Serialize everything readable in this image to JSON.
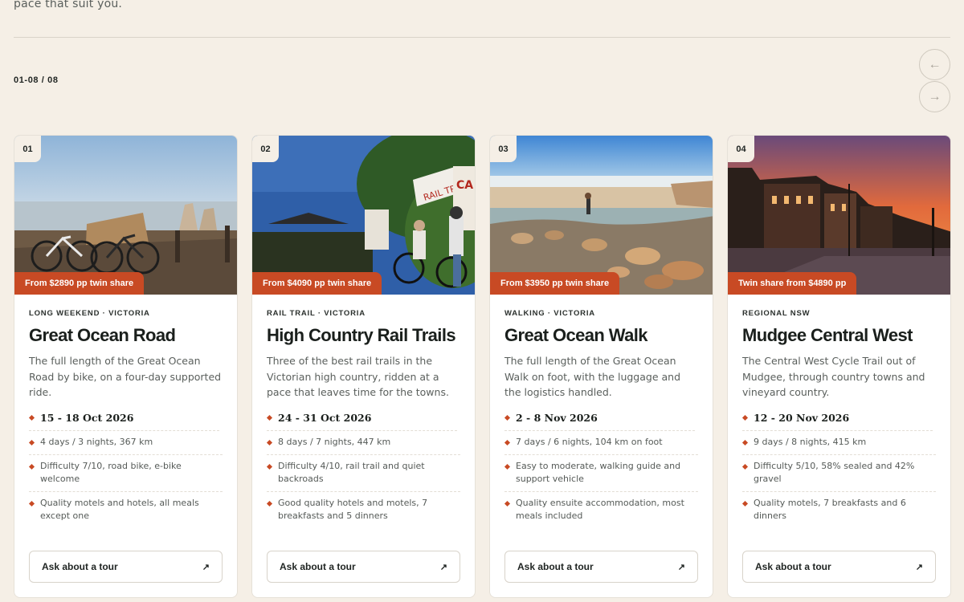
{
  "intro_text": "pace that suit you.",
  "counter": "01-08 / 08",
  "nav": {
    "prev_icon": "←",
    "next_icon": "→"
  },
  "cta_label": "Ask about a tour",
  "cta_icon": "↗",
  "accent_color": "#c84a24",
  "tours": [
    {
      "num": "01",
      "price": "From $2890 pp twin share",
      "kicker": "LONG WEEKEND · VICTORIA",
      "title": "Great Ocean Road",
      "desc": "The full length of the Great Ocean Road by bike, on a four-day supported ride.",
      "dates": "15 - 18 Oct 2026",
      "facts": [
        "4 days / 3 nights, 367 km",
        "Difficulty 7/10, road bike, e-bike welcome",
        "Quality motels and hotels, all meals except one"
      ]
    },
    {
      "num": "02",
      "price": "From $4090 pp twin share",
      "kicker": "RAIL TRAIL · VICTORIA",
      "title": "High Country Rail Trails",
      "desc": "Three of the best rail trails in the Victorian high country, ridden at a pace that leaves time for the towns.",
      "dates": "24 - 31 Oct 2026",
      "facts": [
        "8 days / 7 nights, 447 km",
        "Difficulty 4/10, rail trail and quiet backroads",
        "Good quality hotels and motels, 7 breakfasts and 5 dinners"
      ]
    },
    {
      "num": "03",
      "price": "From $3950 pp twin share",
      "kicker": "WALKING · VICTORIA",
      "title": "Great Ocean Walk",
      "desc": "The full length of the Great Ocean Walk on foot, with the luggage and the logistics handled.",
      "dates": "2 - 8 Nov 2026",
      "facts": [
        "7 days / 6 nights, 104 km on foot",
        "Easy to moderate, walking guide and support vehicle",
        "Quality ensuite accommodation, most meals included"
      ]
    },
    {
      "num": "04",
      "price": "Twin share from $4890 pp",
      "kicker": "REGIONAL NSW",
      "title": "Mudgee Central West",
      "desc": "The Central West Cycle Trail out of Mudgee, through country towns and vineyard country.",
      "dates": "12 - 20 Nov 2026",
      "facts": [
        "9 days / 8 nights, 415 km",
        "Difficulty 5/10, 58% sealed and 42% gravel",
        "Quality motels, 7 breakfasts and 6 dinners"
      ]
    }
  ]
}
